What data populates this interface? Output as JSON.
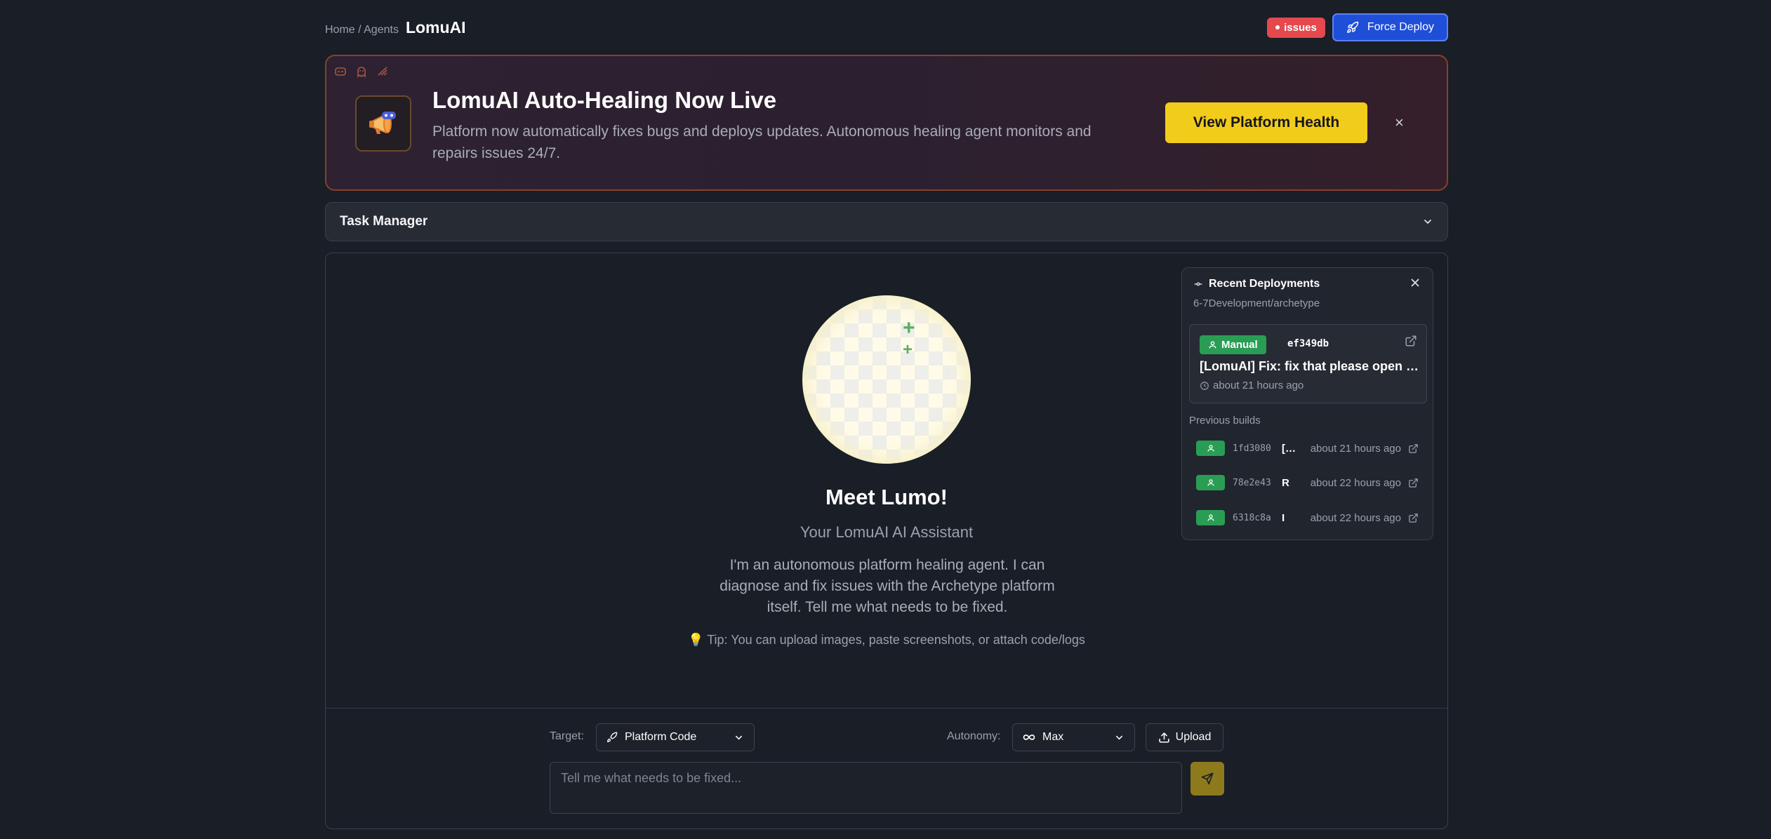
{
  "header": {
    "breadcrumb": "Home / Agents",
    "title": "LomuAI",
    "issues_label": "issues",
    "force_deploy_label": "Force Deploy"
  },
  "banner": {
    "heading": "LomuAI Auto-Healing Now Live",
    "description": "Platform now automatically fixes bugs and deploys updates. Autonomous healing agent monitors and repairs issues 24/7.",
    "cta_label": "View Platform Health",
    "close_label": "×"
  },
  "task_manager": {
    "label": "Task Manager"
  },
  "assistant": {
    "heading": "Meet Lumo!",
    "subtitle": "Your LomuAI AI Assistant",
    "intro": "I'm an autonomous platform healing agent. I can diagnose and fix issues with the Archetype platform itself. Tell me what needs to be fixed.",
    "tip": "Tip: You can upload images, paste screenshots, or attach code/logs"
  },
  "composer": {
    "target_label": "Target:",
    "target_value": "Platform Code",
    "autonomy_label": "Autonomy:",
    "autonomy_value": "Max",
    "upload_label": "Upload",
    "input_placeholder": "Tell me what needs to be fixed..."
  },
  "deployments": {
    "title": "Recent Deployments",
    "repo": "6-7Development/archetype",
    "latest": {
      "type": "Manual",
      "hash": "ef349db",
      "message": "[LomuAI] Fix: fix that please open the app",
      "time": "about 21 hours ago"
    },
    "previous_label": "Previous builds",
    "previous": [
      {
        "hash": "1fd3080",
        "message": "[LomuAI]",
        "time": "about 21 hours ago"
      },
      {
        "hash": "78e2e43",
        "message": "R",
        "time": "about 22 hours ago"
      },
      {
        "hash": "6318c8a",
        "message": "I",
        "time": "about 22 hours ago"
      }
    ]
  },
  "colors": {
    "background": "#1a1e26",
    "issues_badge": "#e5484d",
    "force_deploy": "#1f4fd8",
    "cta_yellow": "#f2cc1b",
    "success_green": "#2a9d55",
    "banner_border": "#8a3f2a"
  }
}
